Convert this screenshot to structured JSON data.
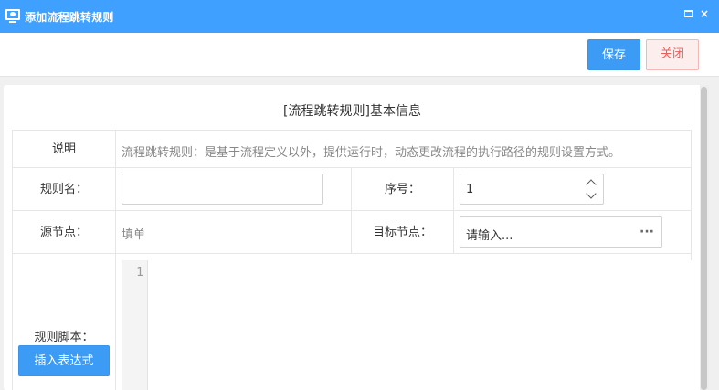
{
  "window": {
    "title": "添加流程跳转规则",
    "app_icon": "monitor-icon",
    "maximize_icon": "maximize-icon",
    "close_icon": "close-icon",
    "close_glyph": "×"
  },
  "toolbar": {
    "save_label": "保存",
    "close_label": "关闭"
  },
  "form": {
    "section_title": "[流程跳转规则]基本信息",
    "description_label": "说明",
    "description_text": "流程跳转规则：是基于流程定义以外，提供运行时，动态更改流程的执行路径的规则设置方式。",
    "rule_name_label": "规则名：",
    "rule_name_value": "",
    "seq_label": "序号：",
    "seq_value": "1",
    "source_node_label": "源节点：",
    "source_node_value": "填单",
    "target_node_label": "目标节点：",
    "target_node_placeholder": "请输入...",
    "target_node_value": "",
    "script_label": "规则脚本：",
    "insert_expr_label": "插入表达式",
    "editor_line_number": "1"
  },
  "colors": {
    "titlebar": "#3fa0ff",
    "primary": "#3c9cf5",
    "danger_bg": "#fdeeee",
    "danger_text": "#e8605b"
  }
}
